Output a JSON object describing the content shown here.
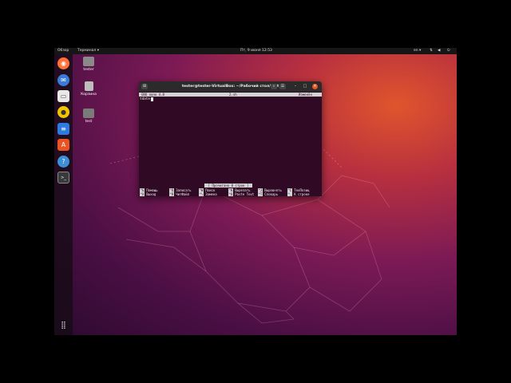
{
  "topbar": {
    "activities": "Обзор",
    "app_menu": "Терминал ▾",
    "clock": "Пт, 9 июня 12:53",
    "keyboard_layout": "en ▾",
    "system_icons": [
      "network-icon",
      "volume-icon",
      "power-icon"
    ]
  },
  "dock": {
    "items": [
      {
        "icon": "firefox-icon",
        "color": "#ff7139"
      },
      {
        "icon": "thunderbird-icon",
        "color": "#3b7bd8"
      },
      {
        "icon": "files-icon",
        "color": "#e8e8e8"
      },
      {
        "icon": "rhythmbox-icon",
        "color": "#f5c400"
      },
      {
        "icon": "libreoffice-writer-icon",
        "color": "#2d7be0"
      },
      {
        "icon": "software-icon",
        "color": "#e95420"
      },
      {
        "icon": "help-icon",
        "color": "#3d8fd8"
      },
      {
        "icon": "terminal-icon",
        "color": "#3a3a3a"
      }
    ],
    "show_apps_icon": "grid-icon"
  },
  "desktop": {
    "icons": [
      {
        "label": "tester",
        "icon": "home-folder-icon"
      },
      {
        "label": "Корзина",
        "icon": "trash-icon"
      },
      {
        "label": "test",
        "icon": "folder-icon"
      }
    ]
  },
  "terminal": {
    "title": "tester@tester-VirtualBox: ~/Рабочий стол/test",
    "buttons": {
      "menu": "☰",
      "search": "🔍",
      "minimize": "–",
      "maximize": "□",
      "close": "×"
    },
    "nano": {
      "version": "GNU nano 4.8",
      "filename": "2.sh",
      "state": "Изменён",
      "line_text": "tdate",
      "status_message": "[ Прочитано 0 строк ]",
      "shortcuts_row1": [
        {
          "key": "^G",
          "label": "Помощь"
        },
        {
          "key": "^O",
          "label": "Записать"
        },
        {
          "key": "^W",
          "label": "Поиск"
        },
        {
          "key": "^K",
          "label": "Вырезать"
        },
        {
          "key": "^J",
          "label": "Выровнять"
        },
        {
          "key": "^C",
          "label": "ТекПозиц"
        }
      ],
      "shortcuts_row2": [
        {
          "key": "^X",
          "label": "Выход"
        },
        {
          "key": "^R",
          "label": "ЧитФайл"
        },
        {
          "key": "^\\",
          "label": "Замена"
        },
        {
          "key": "^U",
          "label": "Paste Text"
        },
        {
          "key": "^T",
          "label": "Словарь"
        },
        {
          "key": "^_",
          "label": "К строке"
        }
      ]
    }
  },
  "colors": {
    "terminal_bg": "#300a24",
    "accent": "#e95420",
    "wallpaper_deep": "#2c0a2e"
  }
}
